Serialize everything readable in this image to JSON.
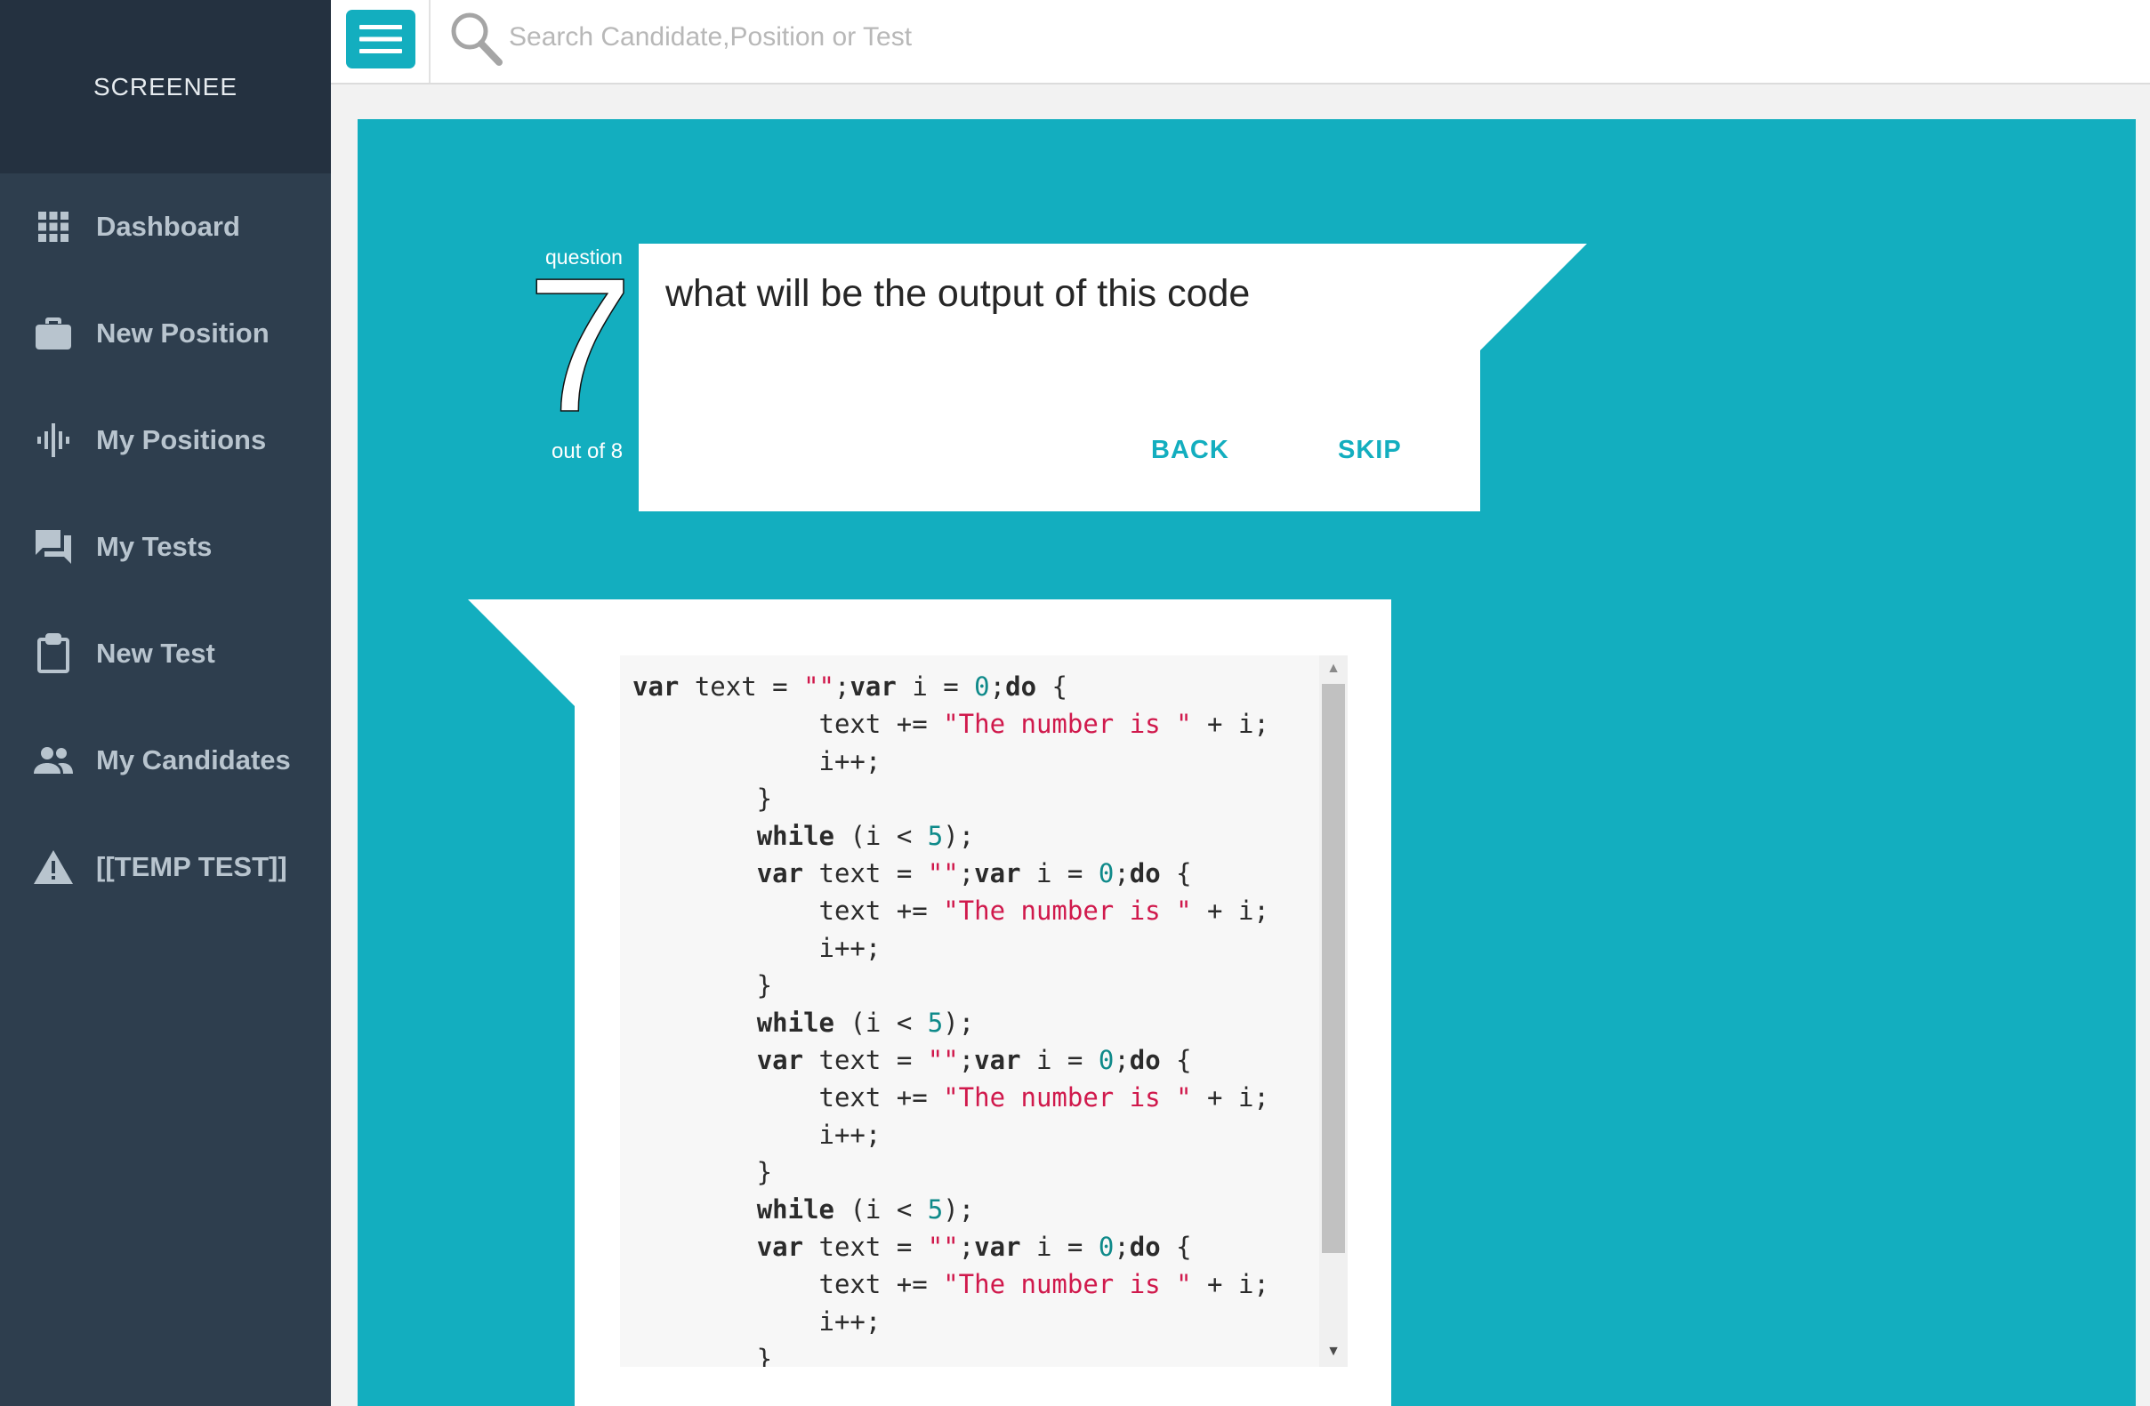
{
  "app": {
    "brand": "SCREENEE"
  },
  "sidebar": {
    "items": [
      {
        "label": "Dashboard",
        "icon": "grid-icon"
      },
      {
        "label": "New Position",
        "icon": "briefcase-icon"
      },
      {
        "label": "My Positions",
        "icon": "waveform-icon"
      },
      {
        "label": "My Tests",
        "icon": "chat-bubbles-icon"
      },
      {
        "label": "New Test",
        "icon": "clipboard-icon"
      },
      {
        "label": "My Candidates",
        "icon": "people-icon"
      },
      {
        "label": "[[TEMP TEST]]",
        "icon": "warning-icon"
      }
    ]
  },
  "topbar": {
    "menu_icon": "hamburger-menu-icon",
    "search_icon": "search-icon",
    "search_placeholder": "Search Candidate,Position or Test"
  },
  "question": {
    "word": "question",
    "number": "7",
    "total_label": "out of 8",
    "text": "what will be the output of this code",
    "back_label": "BACK",
    "skip_label": "SKIP"
  },
  "code": {
    "lines": [
      "var text = \"\";var i = 0;do {",
      "            text += \"The number is \" + i;",
      "            i++;",
      "        }",
      "        while (i < 5);",
      "        var text = \"\";var i = 0;do {",
      "            text += \"The number is \" + i;",
      "            i++;",
      "        }",
      "        while (i < 5);",
      "        var text = \"\";var i = 0;do {",
      "            text += \"The number is \" + i;",
      "            i++;",
      "        }",
      "        while (i < 5);",
      "        var text = \"\";var i = 0;do {",
      "            text += \"The number is \" + i;",
      "            i++;",
      "        }"
    ]
  },
  "colors": {
    "accent": "#13aebf",
    "sidebar": "#2e3e4e",
    "sidebar_header": "#243140",
    "string": "#d0194c",
    "number": "#0f8a8a"
  }
}
